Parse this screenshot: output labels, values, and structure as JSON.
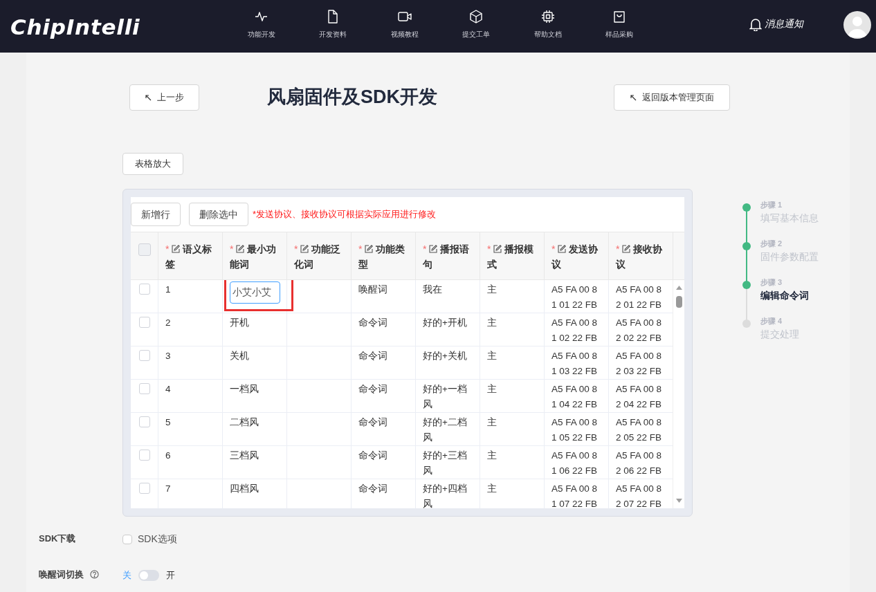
{
  "header": {
    "logo": "ChipIntelli",
    "nav": [
      {
        "kind": "pulse",
        "label": "功能开发"
      },
      {
        "kind": "file",
        "label": "开发资料"
      },
      {
        "kind": "video",
        "label": "视频教程"
      },
      {
        "kind": "cube",
        "label": "提交工单"
      },
      {
        "kind": "chip",
        "label": "帮助文档"
      },
      {
        "kind": "bag",
        "label": "样品采购"
      }
    ],
    "notify": "消息通知"
  },
  "back_button": "上一步",
  "title": "风扇固件及SDK开发",
  "return_button": "返回版本管理页面",
  "zoom_button": "表格放大",
  "toolbar": {
    "add_button": "新增行",
    "delete_button": "删除选中",
    "note": "*发送协议、接收协议可根据实际应用进行修改"
  },
  "table": {
    "all_checked": false,
    "columns": [
      {
        "required_mark": "*",
        "label": "语义标签"
      },
      {
        "required_mark": "*",
        "label": "最小功能词"
      },
      {
        "required_mark": "*",
        "label": "功能泛化词"
      },
      {
        "required_mark": "*",
        "label": "功能类型"
      },
      {
        "required_mark": "*",
        "label": "播报语句"
      },
      {
        "required_mark": "*",
        "label": "播报模式"
      },
      {
        "required_mark": "*",
        "label": "发送协议"
      },
      {
        "required_mark": "*",
        "label": "接收协议"
      }
    ],
    "rows": [
      {
        "checked": false,
        "cells": [
          "1",
          "小艾小艾",
          "",
          "唤醒词",
          "我在",
          "主",
          "A5 FA 00 81 01 22 FB",
          "A5 FA 00 82 01 22 FB"
        ],
        "editing": true
      },
      {
        "checked": false,
        "cells": [
          "2",
          "开机",
          "",
          "命令词",
          "好的+开机",
          "主",
          "A5 FA 00 81 02 22 FB",
          "A5 FA 00 82 02 22 FB"
        ],
        "editing": false
      },
      {
        "checked": false,
        "cells": [
          "3",
          "关机",
          "",
          "命令词",
          "好的+关机",
          "主",
          "A5 FA 00 81 03 22 FB",
          "A5 FA 00 82 03 22 FB"
        ],
        "editing": false
      },
      {
        "checked": false,
        "cells": [
          "4",
          "一档风",
          "",
          "命令词",
          "好的+一档风",
          "主",
          "A5 FA 00 81 04 22 FB",
          "A5 FA 00 82 04 22 FB"
        ],
        "editing": false
      },
      {
        "checked": false,
        "cells": [
          "5",
          "二档风",
          "",
          "命令词",
          "好的+二档风",
          "主",
          "A5 FA 00 81 05 22 FB",
          "A5 FA 00 82 05 22 FB"
        ],
        "editing": false
      },
      {
        "checked": false,
        "cells": [
          "6",
          "三档风",
          "",
          "命令词",
          "好的+三档风",
          "主",
          "A5 FA 00 81 06 22 FB",
          "A5 FA 00 82 06 22 FB"
        ],
        "editing": false
      },
      {
        "checked": false,
        "cells": [
          "7",
          "四档风",
          "",
          "命令词",
          "好的+四档风",
          "主",
          "A5 FA 00 81 07 22 FB",
          "A5 FA 00 82 07 22 FB"
        ],
        "editing": false
      }
    ]
  },
  "steps": [
    {
      "step": "步骤 1",
      "label": "填写基本信息",
      "done": true,
      "selected": false
    },
    {
      "step": "步骤 2",
      "label": "固件参数配置",
      "done": true,
      "selected": false
    },
    {
      "step": "步骤 3",
      "label": "编辑命令词",
      "done": true,
      "selected": true
    },
    {
      "step": "步骤 4",
      "label": "提交处理",
      "done": false,
      "selected": false
    }
  ],
  "sdk": {
    "label": "SDK下载",
    "option": "SDK选项",
    "checked": false
  },
  "wake_switch": {
    "label": "唤醒词切换",
    "off_label": "关",
    "on_label": "开",
    "on": false
  }
}
